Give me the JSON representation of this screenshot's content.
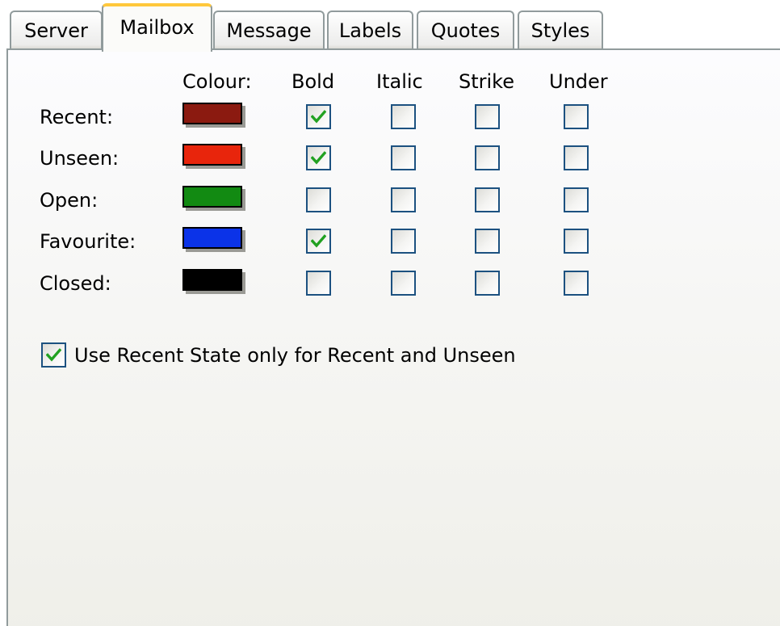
{
  "tabs": [
    {
      "label": "Server",
      "active": false
    },
    {
      "label": "Mailbox",
      "active": true
    },
    {
      "label": "Message",
      "active": false
    },
    {
      "label": "Labels",
      "active": false
    },
    {
      "label": "Quotes",
      "active": false
    },
    {
      "label": "Styles",
      "active": false
    }
  ],
  "headers": {
    "colour": "Colour:",
    "bold": "Bold",
    "italic": "Italic",
    "strike": "Strike",
    "under": "Under"
  },
  "rows": [
    {
      "label": "Recent:",
      "colour": "#8b1a10",
      "bold": true,
      "italic": false,
      "strike": false,
      "under": false
    },
    {
      "label": "Unseen:",
      "colour": "#e8250c",
      "bold": true,
      "italic": false,
      "strike": false,
      "under": false
    },
    {
      "label": "Open:",
      "colour": "#128a12",
      "bold": false,
      "italic": false,
      "strike": false,
      "under": false
    },
    {
      "label": "Favourite:",
      "colour": "#0b33e8",
      "bold": true,
      "italic": false,
      "strike": false,
      "under": false
    },
    {
      "label": "Closed:",
      "colour": "#000000",
      "bold": false,
      "italic": false,
      "strike": false,
      "under": false
    }
  ],
  "recent_state": {
    "label": "Use Recent State only for Recent and Unseen",
    "checked": true
  },
  "colors": {
    "check_mark": "#21a121",
    "checkbox_border": "#1c5180",
    "active_tab_accent": "#ffc83c",
    "tab_border": "#919b9c"
  }
}
